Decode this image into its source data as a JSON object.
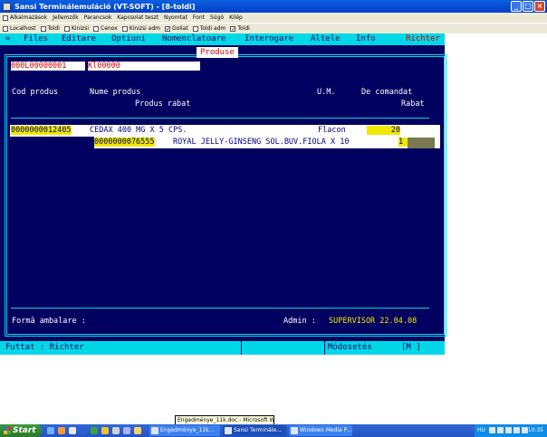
{
  "window": {
    "title": "Sansi Terminálemuláció (VT-SOFT) - [8-toldi]",
    "buttons": [
      "_",
      "□",
      "×"
    ]
  },
  "menubar": [
    "Alkalmazások",
    "Jellemzők",
    "Parancsok",
    "Kapcsolat teszt",
    "Nyomtat",
    "Font",
    "Súgó",
    "Kilép"
  ],
  "toggles": [
    {
      "label": "Localhost",
      "checked": false
    },
    {
      "label": "Toldi",
      "checked": false
    },
    {
      "label": "Kinizsi",
      "checked": false
    },
    {
      "label": "Cenox",
      "checked": false
    },
    {
      "label": "Kinizsi adm",
      "checked": false
    },
    {
      "label": "Goliat",
      "checked": true
    },
    {
      "label": "Toldi adm",
      "checked": false
    },
    {
      "label": "Toldi",
      "checked": true
    }
  ],
  "terminal": {
    "menu": {
      "marker": "=",
      "items": [
        "Files",
        "Editare",
        "Optiuni",
        "Nomenclatoare",
        "Interogare",
        "Altele",
        "Info"
      ],
      "user": "Richter"
    },
    "frame_title": "Produse",
    "search": {
      "code": "000L00000001",
      "name": "Kl00000"
    },
    "headers": {
      "cod": "Cod produs",
      "nume": "Nume produs",
      "rabat_produs": "Produs rabat",
      "um": "U.M.",
      "comandat": "De comandat",
      "rabat": "Rabat"
    },
    "rows": [
      {
        "code": "0000000012405",
        "name": "CEDAX 400 MG X 5 CPS.",
        "um": "Flacon",
        "qty": "20"
      },
      {
        "code": "0000000076555",
        "name": "ROYAL JELLY-GINSENG SOL.BUV.FIOLA X 10",
        "qty": "1"
      }
    ],
    "forma_label": "Formă ambalare :",
    "admin": {
      "label": "Admin :",
      "value": "SUPERVISOR 22.04.08"
    },
    "status": {
      "left": "Futtat  : Richter",
      "right_label": "Módosetés",
      "right_value": "[M    ]"
    }
  },
  "tooltip": "Engedménye_11k.doc - Microsoft Word",
  "taskbar": {
    "start": "Start",
    "tasks": [
      "Engedménye_11k...",
      "Sansi Terminále...",
      "Windows Media P..."
    ],
    "lang": "HU",
    "clock": "10:35"
  }
}
